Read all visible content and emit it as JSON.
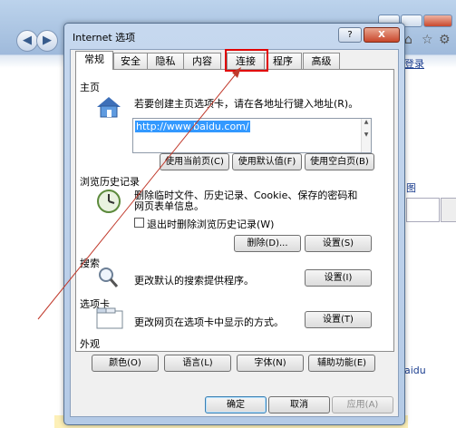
{
  "background": {
    "menu_link": "登录",
    "link_text": "图",
    "bottom_text": "aidu"
  },
  "dialog": {
    "title": "Internet 选项",
    "help_label": "?",
    "close_label": "X",
    "tabs": [
      "常规",
      "安全",
      "隐私",
      "内容",
      "连接",
      "程序",
      "高级"
    ],
    "active_tab": "常规",
    "highlighted_tab": "连接",
    "homepage": {
      "heading": "主页",
      "description": "若要创建主页选项卡，请在各地址行键入地址(R)。",
      "url": "http://www.baidu.com/",
      "use_current": "使用当前页(C)",
      "use_default": "使用默认值(F)",
      "use_blank": "使用空白页(B)"
    },
    "history": {
      "heading": "浏览历史记录",
      "description": "删除临时文件、历史记录、Cookie、保存的密码和网页表单信息。",
      "checkbox_label": "退出时删除浏览历史记录(W)",
      "checkbox_checked": false,
      "delete_button": "删除(D)...",
      "settings_button": "设置(S)"
    },
    "search": {
      "heading": "搜索",
      "description": "更改默认的搜索提供程序。",
      "settings_button": "设置(I)"
    },
    "tabs_section": {
      "heading": "选项卡",
      "description": "更改网页在选项卡中显示的方式。",
      "settings_button": "设置(T)"
    },
    "appearance": {
      "heading": "外观",
      "colors": "颜色(O)",
      "languages": "语言(L)",
      "fonts": "字体(N)",
      "accessibility": "辅助功能(E)"
    },
    "footer": {
      "ok": "确定",
      "cancel": "取消",
      "apply": "应用(A)"
    }
  },
  "colors": {
    "highlight_box": "#e10000",
    "selection": "#3399ff"
  }
}
